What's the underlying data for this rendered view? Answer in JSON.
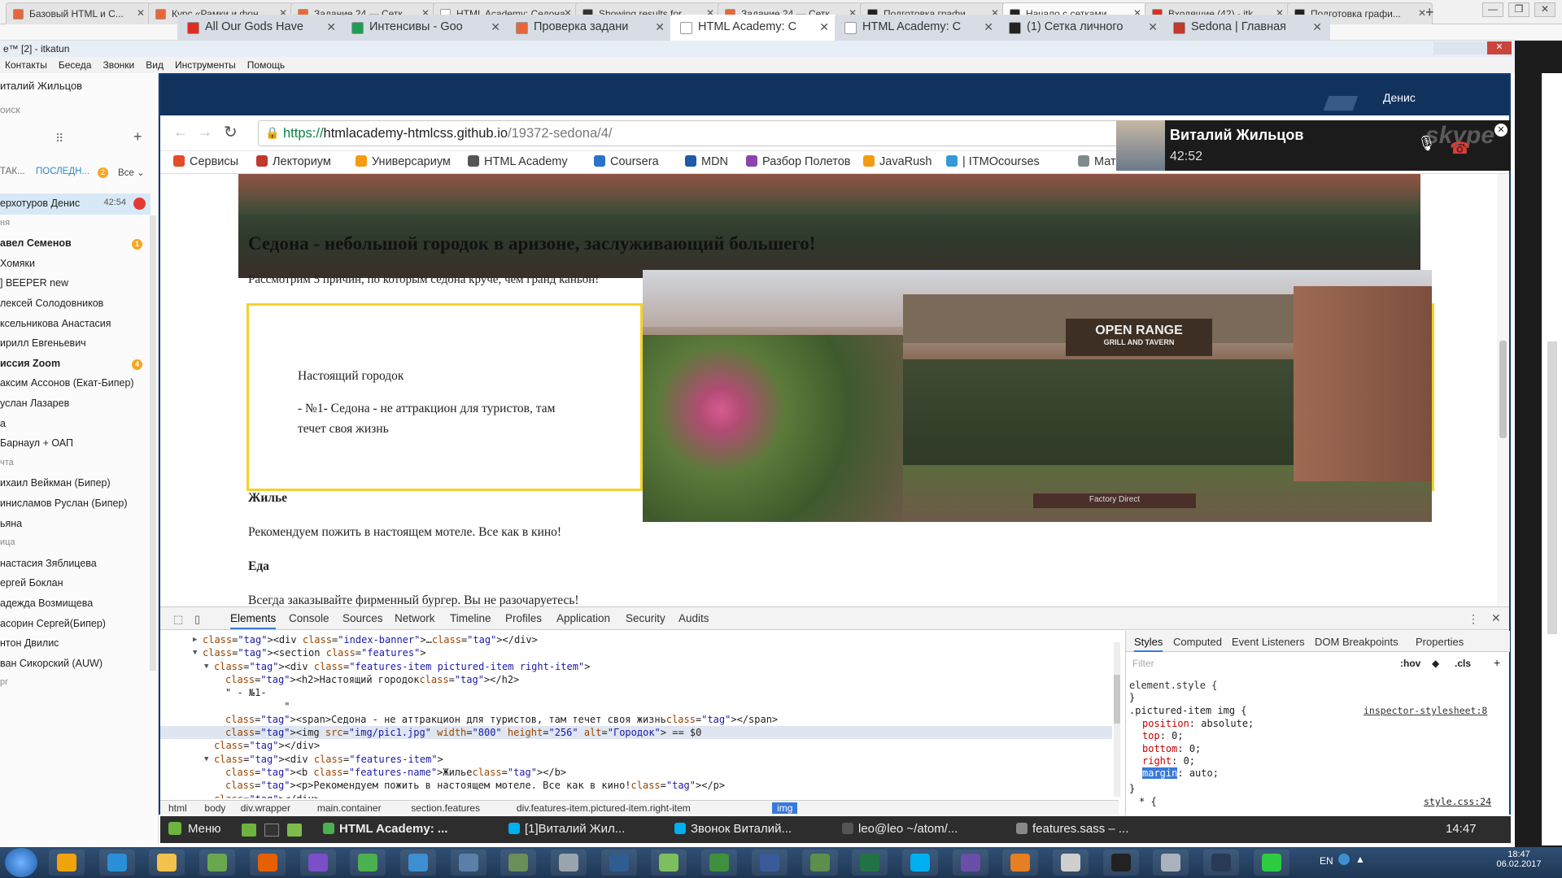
{
  "outer_tabs": [
    {
      "label": "Базовый HTML и С...",
      "color": "#e8673a"
    },
    {
      "label": "Курс «Рамки и фон...",
      "color": "#e8673a"
    },
    {
      "label": "Задание 24 — Сетк...",
      "color": "#e8673a"
    },
    {
      "label": "HTML Academy: Седона",
      "color": "#ffffff"
    },
    {
      "label": "Showing results for ...",
      "color": "#333333"
    },
    {
      "label": "Задание 24 — Сетк...",
      "color": "#e8673a"
    },
    {
      "label": "Подготовка графи...",
      "color": "#222222"
    },
    {
      "label": "Начало с сетками ...",
      "color": "#222222"
    },
    {
      "label": "Входящие (42) - itk...",
      "color": "#d93025"
    },
    {
      "label": "Подготовка графи...",
      "color": "#222222"
    }
  ],
  "skype": {
    "title": "e™ [2] - itkatun",
    "menu": [
      "Контакты",
      "Беседа",
      "Звонки",
      "Вид",
      "Инструменты",
      "Помощь"
    ],
    "user": "италий Жильцов",
    "search_placeholder": "оиск",
    "filters": {
      "a": "ТАК...",
      "b": "ПОСЛЕДН...",
      "b_count": "2",
      "c": "Все"
    },
    "contacts": [
      {
        "name": "ерхотуров Денис",
        "time": "42:54",
        "active": true
      },
      {
        "name": "ня",
        "section": true
      },
      {
        "name": "авел Семенов",
        "badge": "1",
        "bold": true
      },
      {
        "name": "Хомяки"
      },
      {
        "name": "] BEEPER new"
      },
      {
        "name": "лексей Солодовников"
      },
      {
        "name": "ксельникова Анастасия"
      },
      {
        "name": "ирилл Евгеньевич"
      },
      {
        "name": "иссия Zoom",
        "badge": "4",
        "bold": true
      },
      {
        "name": "аксим Ассонов (Екат-Бипер)"
      },
      {
        "name": "услан Лазарев"
      },
      {
        "name": "а"
      },
      {
        "name": "Барнаул + ОАП"
      },
      {
        "name": "чта",
        "section": true
      },
      {
        "name": "ихаил Вейкман (Бипер)"
      },
      {
        "name": "инисламов Руслан (Бипер)"
      },
      {
        "name": "ьяна"
      },
      {
        "name": "ица",
        "section": true
      },
      {
        "name": "настасия Зяблицева"
      },
      {
        "name": "ергей Боклан"
      },
      {
        "name": "адежда Возмищева"
      },
      {
        "name": "асорин Сергей(Бипер)"
      },
      {
        "name": "нтон Двилис"
      },
      {
        "name": "ван Сикорский (AUW)"
      },
      {
        "name": "рг",
        "section": true
      }
    ]
  },
  "browser": {
    "tabs": [
      {
        "label": "All Our Gods Have",
        "color": "#e02b20"
      },
      {
        "label": "Интенсивы - Goo",
        "color": "#1e9e55"
      },
      {
        "label": "Проверка задани",
        "color": "#e8673a"
      },
      {
        "label": "HTML Academy: C",
        "color": "#ffffff"
      },
      {
        "label": "HTML Academy: C",
        "color": "#ffffff"
      },
      {
        "label": "(1) Сетка личного",
        "color": "#222222"
      },
      {
        "label": "Sedona | Главная",
        "color": "#c0392b"
      }
    ],
    "profile": "Денис",
    "url_secure": "https://",
    "url_host": "htmlacademy-htmlcss.github.io",
    "url_path": "/19372-sedona/4/",
    "bookmarks": [
      {
        "label": "Сервисы",
        "color": "#e34c26"
      },
      {
        "label": "Лекториум",
        "color": "#c0392b"
      },
      {
        "label": "Универсариум",
        "color": "#f39c12"
      },
      {
        "label": "HTML Academy",
        "color": "#555555"
      },
      {
        "label": "Coursera",
        "color": "#2a73cc"
      },
      {
        "label": "MDN",
        "color": "#1e5aa8"
      },
      {
        "label": "Разбор Полетов",
        "color": "#8e44ad"
      },
      {
        "label": "JavaRush",
        "color": "#f39c12"
      },
      {
        "label": "| ITMOcourses",
        "color": "#3498db"
      },
      {
        "label": "Мате",
        "color": "#7f8c8d"
      }
    ]
  },
  "call": {
    "name": "Виталий Жильцов",
    "time": "42:52",
    "app": "skype"
  },
  "page": {
    "heading": "Седона - небольшой городок в аризоне, заслуживающий большего!",
    "intro": "Рассмотрим 5 причин, по которым седона круче, чем гранд каньон!",
    "feature_title": "Настоящий городок",
    "feature_text_1": "- №1- Седона - не аттракцион для туристов, там",
    "feature_text_2": "течет своя жизнь",
    "housing_title": "Жилье",
    "housing_text": "Рекомендуем пожить в настоящем мотеле. Все как в кино!",
    "food_title": "Еда",
    "food_text": "Всегда заказывайте фирменный бургер. Вы не разочаруетесь!",
    "photo_sign_1": "OPEN RANGE",
    "photo_sign_2": "GRILL AND TAVERN",
    "photo_sign_3": "Factory Direct"
  },
  "devtools": {
    "tabs": [
      "Elements",
      "Console",
      "Sources",
      "Network",
      "Timeline",
      "Profiles",
      "Application",
      "Security",
      "Audits"
    ],
    "dom": [
      {
        "indent": 0,
        "arrow": "▶",
        "html": "<div class=\"index-banner\">…</div>"
      },
      {
        "indent": 0,
        "arrow": "▼",
        "html": "<section class=\"features\">"
      },
      {
        "indent": 1,
        "arrow": "▼",
        "html": "<div class=\"features-item pictured-item right-item\">"
      },
      {
        "indent": 2,
        "arrow": "",
        "html": "<h2>Настоящий городок</h2>"
      },
      {
        "indent": 2,
        "arrow": "",
        "html": "\" - №1-"
      },
      {
        "indent": 2,
        "arrow": "",
        "html": "          \""
      },
      {
        "indent": 2,
        "arrow": "",
        "html": "<span>Седона - не аттракцион для туристов, там течет своя жизнь</span>"
      },
      {
        "indent": 2,
        "arrow": "",
        "html": "<img src=\"img/pic1.jpg\" width=\"800\" height=\"256\" alt=\"Городок\"> == $0",
        "selected": true
      },
      {
        "indent": 1,
        "arrow": "",
        "html": "</div>"
      },
      {
        "indent": 1,
        "arrow": "▼",
        "html": "<div class=\"features-item\">"
      },
      {
        "indent": 2,
        "arrow": "",
        "html": "<b class=\"features-name\">Жилье</b>"
      },
      {
        "indent": 2,
        "arrow": "",
        "html": "<p>Рекомендуем пожить в настоящем мотеле. Все как в кино!</p>"
      },
      {
        "indent": 1,
        "arrow": "",
        "html": "</div>"
      }
    ],
    "breadcrumbs": [
      "html",
      "body",
      "div.wrapper",
      "main.container",
      "section.features",
      "div.features-item.pictured-item.right-item",
      "img"
    ],
    "style_tabs": [
      "Styles",
      "Computed",
      "Event Listeners",
      "DOM Breakpoints",
      "Properties"
    ],
    "filter_placeholder": "Filter",
    "hov": ":hov",
    "cls": ".cls",
    "element_style": "element.style {",
    "rule_selector": ".pictured-item img {",
    "rule_source": "inspector-stylesheet:8",
    "props": [
      {
        "name": "position",
        "value": "absolute;"
      },
      {
        "name": "top",
        "value": "0;"
      },
      {
        "name": "bottom",
        "value": "0;"
      },
      {
        "name": "right",
        "value": "0;"
      },
      {
        "name": "margin",
        "value": "auto;",
        "highlight": true
      }
    ],
    "next_source": "style.css:24",
    "next_selector": "* {"
  },
  "linux_bar": {
    "menu": "Меню",
    "windows": [
      "HTML Academy: ...",
      "[1]Виталий Жил...",
      "Звонок Виталий...",
      "leo@leo ~/atom/...",
      "features.sass – ..."
    ],
    "time": "14:47"
  },
  "taskbar": {
    "lang": "EN",
    "time": "18:47",
    "date": "06.02.2017",
    "icons": [
      {
        "name": "outlook",
        "color": "#f0a30a"
      },
      {
        "name": "ie",
        "color": "#2a8fd6"
      },
      {
        "name": "explorer",
        "color": "#f2c14e"
      },
      {
        "name": "notepad",
        "color": "#6aa84f"
      },
      {
        "name": "firefox",
        "color": "#e66000"
      },
      {
        "name": "headset",
        "color": "#7b4fc9"
      },
      {
        "name": "chrome",
        "color": "#4caf50"
      },
      {
        "name": "phone",
        "color": "#3d8fd1"
      },
      {
        "name": "network",
        "color": "#5a7fa8"
      },
      {
        "name": "turtle",
        "color": "#6b8e5a"
      },
      {
        "name": "database",
        "color": "#9aa4ad"
      },
      {
        "name": "qip",
        "color": "#2f5d91"
      },
      {
        "name": "counter",
        "color": "#7cbf5e"
      },
      {
        "name": "hs",
        "color": "#3f8f3f"
      },
      {
        "name": "save",
        "color": "#3a5a9a"
      },
      {
        "name": "sheet",
        "color": "#5b8f4b"
      },
      {
        "name": "excel",
        "color": "#217346"
      },
      {
        "name": "skype",
        "color": "#00aff0"
      },
      {
        "name": "cat",
        "color": "#6a4fa8"
      },
      {
        "name": "sublime",
        "color": "#e67e22"
      },
      {
        "name": "tool",
        "color": "#cfcfcf"
      },
      {
        "name": "terminal",
        "color": "#222222"
      },
      {
        "name": "calc",
        "color": "#aab3bd"
      },
      {
        "name": "r-app",
        "color": "#2a3a55"
      },
      {
        "name": "s-app",
        "color": "#2ecc40"
      }
    ]
  }
}
